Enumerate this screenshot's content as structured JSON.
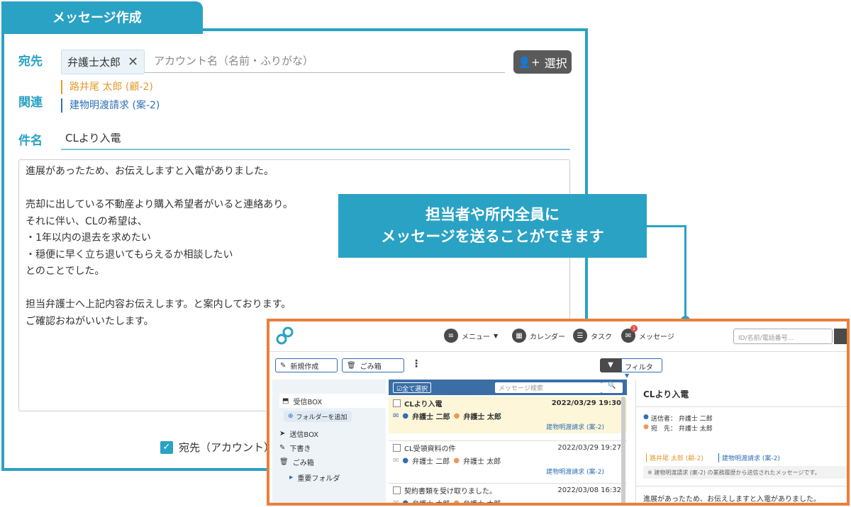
{
  "composer": {
    "tab_title": "メッセージ作成",
    "to_label": "宛先",
    "to_chip": "弁護士太郎",
    "to_placeholder": "アカウント名（名前・ふりがな）",
    "select_button": "選択",
    "related_label": "関連",
    "related": [
      {
        "text": "路井尾 太郎 (顧-2)",
        "color": "#e39a2e"
      },
      {
        "text": "建物明渡請求 (案-2)",
        "color": "#2f6fb5"
      }
    ],
    "subject_label": "件名",
    "subject_value": "CLより入電",
    "body_lines": [
      "進展があったため、お伝えしますと入電がありました。",
      "",
      "売却に出している不動産より購入希望者がいると連絡あり。",
      "それに伴い、CLの希望は、",
      "・1年以内の退去を求めたい",
      "・穏便に早く立ち退いてもらえるか相談したい",
      "とのことでした。",
      "",
      "担当弁護士へ上記内容お伝えします。と案内しております。",
      "ご確認おねがいいたします。"
    ],
    "checkbox_label": "宛先（アカウント）"
  },
  "callout": {
    "line1": "担当者や所内全員に",
    "line2": "メッセージを送ることができます"
  },
  "app": {
    "nav": {
      "menu": "メニュー",
      "calendar": "カレンダー",
      "task": "タスク",
      "message": "メッセージ",
      "message_badge": "1",
      "search_placeholder": "ID/名前/電話番号..."
    },
    "toolbar": {
      "new": "新規作成",
      "trash": "ごみ箱",
      "filter": "フィルタ"
    },
    "sidebar": {
      "inbox": "受信BOX",
      "add_folder": "フォルダーを追加",
      "sent": "送信BOX",
      "drafts": "下書き",
      "trash": "ごみ箱",
      "important": "重要フォルダ"
    },
    "list_header": {
      "select_all": "全て選択",
      "search_placeholder": "メッセージ検索"
    },
    "messages": [
      {
        "subject": "CLより入電",
        "date": "2022/03/29 19:30",
        "from": "弁護士 二郎",
        "to": "弁護士 太郎",
        "tag": "建物明渡請求 (案-2)"
      },
      {
        "subject": "CL受領資料の件",
        "date": "2022/03/29 19:27",
        "from": "弁護士 二郎",
        "to": "弁護士 太郎",
        "tag": "建物明渡請求 (案-2)"
      },
      {
        "subject": "契約書類を受け取りました。",
        "date": "2022/03/08 16:32",
        "from": "弁護士 太郎",
        "to": "弁護士 太郎",
        "tag": ""
      }
    ],
    "detail": {
      "title": "CLより入電",
      "sender_label": "送信者：",
      "sender": "弁護士 二郎",
      "to_label": "宛　先：",
      "to": "弁護士 太郎",
      "tag1": "路井尾 太郎 (顧-2)",
      "tag2": "建物明渡請求 (案-2)",
      "note": "※ 建物明渡請求 (案-2) の業務履歴から送信されたメッセージです。",
      "body_first": "進展があったため、お伝えしますと入電がありました。"
    }
  }
}
